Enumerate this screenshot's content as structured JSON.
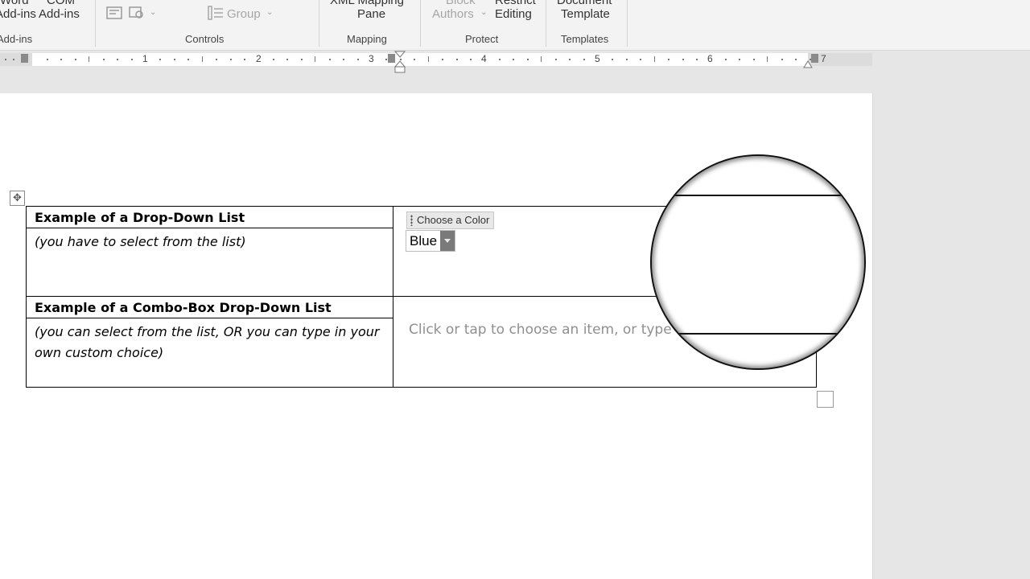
{
  "ribbon": {
    "addins": {
      "line1_left": "Word",
      "line1_right": "COM",
      "left_label": "Add-ins",
      "right_label": "Add-ins",
      "group": "Add-ins"
    },
    "controls": {
      "group": "Controls",
      "group_button": "Group"
    },
    "mapping": {
      "line1": "XML Mapping",
      "line2": "Pane",
      "group": "Mapping"
    },
    "protect": {
      "block_line1": "Block",
      "block_line2": "Authors",
      "restrict_line1": "Restrict",
      "restrict_line2": "Editing",
      "group": "Protect"
    },
    "templates": {
      "line1": "Document",
      "line2": "Template",
      "group": "Templates"
    }
  },
  "ruler": {
    "numbers": [
      "1",
      "2",
      "3",
      "4",
      "5",
      "6",
      "7"
    ]
  },
  "table": {
    "row1_heading": "Example of a Drop-Down List",
    "row1_note": "(you have to select from the list)",
    "content_control_tag": "Choose a Color",
    "dropdown_value": "Blue",
    "row2_heading": "Example of a Combo-Box Drop-Down List",
    "row2_note": "(you can select from the list, OR you can type in your own custom choice)",
    "combo_placeholder": "Click or tap to choose an item, or type"
  },
  "icons": [
    "table-move-handle-icon",
    "dropdown-arrow-icon",
    "legacy-tools-icon",
    "design-mode-icon",
    "group-icon",
    "magnifier-lens"
  ]
}
